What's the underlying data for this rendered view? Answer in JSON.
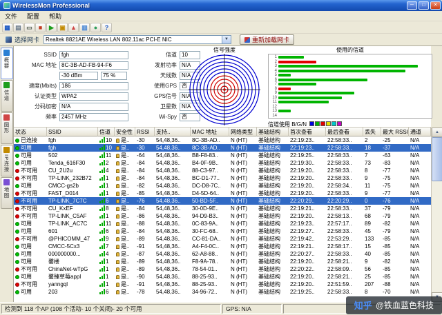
{
  "window": {
    "title": "WirelessMon Professional",
    "minimize_label": "─",
    "maximize_label": "□",
    "close_label": "✕"
  },
  "menu": {
    "items": [
      "文件",
      "配置",
      "帮助"
    ]
  },
  "toolbar": {
    "icons": [
      {
        "name": "save-icon",
        "glyph": "▦",
        "color": "#1a57c4"
      },
      {
        "name": "export-icon",
        "glyph": "▤",
        "color": "#6b7b8c"
      },
      {
        "name": "print-icon",
        "glyph": "▭",
        "color": "#556055"
      },
      {
        "name": "stop-icon",
        "glyph": "■",
        "color": "#c23b22"
      },
      {
        "name": "start-icon",
        "glyph": "▶",
        "color": "#1d9e1d"
      },
      {
        "name": "summary-icon",
        "glyph": "▣",
        "color": "#c28a00"
      },
      {
        "name": "graph-icon",
        "glyph": "▲",
        "color": "#d04545"
      },
      {
        "name": "channels-icon",
        "glyph": "▥",
        "color": "#3b7fd4"
      },
      {
        "name": "map-icon",
        "glyph": "●",
        "color": "#2e9e5b"
      },
      {
        "name": "help-icon",
        "glyph": "?",
        "color": "#1a57c4"
      }
    ]
  },
  "adapter": {
    "label": "选择网卡",
    "value": "Realtek 8821AE Wireless LAN 802.11ac PCI-E NIC",
    "reload_button": "重新加载网卡"
  },
  "icons": {
    "combo_arrow": "▼",
    "scroll_up": "▲",
    "scroll_down": "▼"
  },
  "sidebar": {
    "tabs": [
      {
        "label": "概要",
        "color": "#2a7fd4",
        "active": true
      },
      {
        "label": "信道",
        "color": "#1d9e1d",
        "active": false
      },
      {
        "label": "图形",
        "color": "#d04545",
        "active": false
      },
      {
        "label": "IP连接",
        "color": "#c28a00",
        "active": false
      },
      {
        "label": "地图",
        "color": "#7a4fd4",
        "active": false
      }
    ]
  },
  "summary": {
    "radar_title": "信号强度",
    "fields_left": [
      {
        "label": "SSID",
        "value": "fgh"
      },
      {
        "label": "MAC 地址",
        "value": "8C-3B-AD-FB-94-F6"
      },
      {
        "label": "",
        "value": "-30 dBm",
        "value2": "75 %"
      },
      {
        "label": "速度(Mbits)",
        "value": "186"
      },
      {
        "label": "认证类型",
        "value": "WPA2"
      },
      {
        "label": "分码加密",
        "value": "N/A"
      },
      {
        "label": "频率",
        "value": "2457 MHz"
      }
    ],
    "fields_right": [
      {
        "label": "信道",
        "value": "10"
      },
      {
        "label": "发射功率",
        "value": "N/A"
      },
      {
        "label": "天线数",
        "value": "N/A"
      },
      {
        "label": "使用GPS",
        "value": "否"
      },
      {
        "label": "GPS信号",
        "value": "N/A"
      },
      {
        "label": "卫星数",
        "value": "N/A"
      },
      {
        "label": "Wi-Spy",
        "value": "否"
      }
    ]
  },
  "chart_data": {
    "type": "bar",
    "orientation": "horizontal",
    "title": "使用的信道",
    "categories": [
      "1",
      "2",
      "3",
      "4",
      "5",
      "6",
      "7",
      "8",
      "9",
      "10",
      "11",
      "12",
      "13",
      "14"
    ],
    "values": [
      2,
      3,
      11,
      10,
      1,
      7,
      3,
      1,
      6,
      5,
      4,
      0,
      1,
      0
    ],
    "bar_colors": [
      "#00b400",
      "#e00000",
      "#00b400",
      "#00b400",
      "#00b400",
      "#00b400",
      "#00b400",
      "#e00000",
      "#00b400",
      "#00b400",
      "#00b400",
      "#00b400",
      "#00b400",
      "#00b400"
    ],
    "xlim": [
      0,
      12
    ],
    "legend_label": "信道使用 B/G/N",
    "legend_colors": [
      "#0000e0",
      "#00b400",
      "#e00000",
      "#e0e000",
      "#00c8c8",
      "#c800c8"
    ]
  },
  "table": {
    "columns": [
      "状态",
      "SSID",
      "信道",
      "安全性",
      "RSSI",
      "支持..",
      "MAC 地址",
      "网络类型",
      "基础结构",
      "首次查看",
      "最后查看",
      "丢失",
      "最大 RSSI",
      "通道"
    ],
    "rows": [
      {
        "status": "已连接",
        "dot": "#00c000",
        "ssid": "fgh",
        "channel": "10",
        "security": "是..",
        "rssi": "-30",
        "rates": "54,48,36..",
        "mac": "8C-3B-AD..",
        "type": "N (HT)",
        "infra": "基础结构",
        "first": "22:19:23..",
        "last": "22:58:33..",
        "lost": "2",
        "max_rssi": "-25",
        "extra": "N/A",
        "selected": false
      },
      {
        "status": "可用",
        "dot": "#00c000",
        "ssid": "fgh",
        "channel": "10",
        "security": "是..",
        "rssi": "-30",
        "rates": "54,48,36..",
        "mac": "8C-3B-AD..",
        "type": "N (HT)",
        "infra": "基础结构",
        "first": "22:19:23..",
        "last": "22:58:33..",
        "lost": "18",
        "max_rssi": "-37",
        "extra": "N/A",
        "selected": true
      },
      {
        "status": "可用",
        "dot": "#00c000",
        "ssid": "502",
        "channel": "11",
        "security": "是..",
        "rssi": "-64",
        "rates": "54,48,36..",
        "mac": "B8-F8-83..",
        "type": "N (HT)",
        "infra": "基础结构",
        "first": "22:19:25..",
        "last": "22:58:33..",
        "lost": "7",
        "max_rssi": "-63",
        "extra": "N/A",
        "selected": false
      },
      {
        "status": "可用",
        "dot": "#00c000",
        "ssid": "Tenda_616F30",
        "channel": "2",
        "security": "是..",
        "rssi": "-84",
        "rates": "54,48,36..",
        "mac": "B4-0F-9B..",
        "type": "N (HT)",
        "infra": "基础结构",
        "first": "22:19:30..",
        "last": "22:58:33..",
        "lost": "73",
        "max_rssi": "-83",
        "extra": "N/A",
        "selected": false
      },
      {
        "status": "不可用",
        "dot": "#e00000",
        "ssid": "CU_2U2u",
        "channel": "4",
        "security": "是..",
        "rssi": "-84",
        "rates": "54,48,36..",
        "mac": "88-C3-97..",
        "type": "N (HT)",
        "infra": "基础结构",
        "first": "22:19:20..",
        "last": "22:58:33..",
        "lost": "8",
        "max_rssi": "-77",
        "extra": "N/A",
        "selected": false
      },
      {
        "status": "不可用",
        "dot": "#e00000",
        "ssid": "TP-LINK_232B72",
        "channel": "1",
        "security": "是..",
        "rssi": "-84",
        "rates": "54,48,36..",
        "mac": "BC-D1-77..",
        "type": "N (HT)",
        "infra": "基础结构",
        "first": "22:19:20..",
        "last": "22:58:33..",
        "lost": "9",
        "max_rssi": "-75",
        "extra": "N/A",
        "selected": false
      },
      {
        "status": "可用",
        "dot": "#00c000",
        "ssid": "CMCC-gs2b",
        "channel": "1",
        "security": "是..",
        "rssi": "-82",
        "rates": "54,48,36..",
        "mac": "DC-D8-7C..",
        "type": "N (HT)",
        "infra": "基础结构",
        "first": "22:19:20..",
        "last": "22:58:34..",
        "lost": "11",
        "max_rssi": "-75",
        "extra": "N/A",
        "selected": false
      },
      {
        "status": "不可用",
        "dot": "#e00000",
        "ssid": "FAST_D014",
        "channel": "1",
        "security": "是..",
        "rssi": "-85",
        "rates": "54,48,36..",
        "mac": "D4-5D-64..",
        "type": "N (HT)",
        "infra": "基础结构",
        "first": "22:19:20..",
        "last": "22:58:33..",
        "lost": "9",
        "max_rssi": "-77",
        "extra": "N/A",
        "selected": false
      },
      {
        "status": "不可用",
        "dot": "#e00000",
        "ssid": "TP-LINK_7C7C",
        "channel": "6",
        "security": "是..",
        "rssi": "-76",
        "rates": "54,48,36..",
        "mac": "50-BD-5F..",
        "type": "N (HT)",
        "infra": "基础结构",
        "first": "22:20:29..",
        "last": "22:20:29..",
        "lost": "0",
        "max_rssi": "-76",
        "extra": "N/A",
        "selected": true
      },
      {
        "status": "不可用",
        "dot": "#e00000",
        "ssid": "CU_KxEF",
        "channel": "8",
        "security": "是..",
        "rssi": "-84",
        "rates": "54,48,36..",
        "mac": "30-0D-9E..",
        "type": "N (HT)",
        "infra": "基础结构",
        "first": "22:19:21..",
        "last": "22:58:33..",
        "lost": "37",
        "max_rssi": "-79",
        "extra": "N/A",
        "selected": false
      },
      {
        "status": "不可用",
        "dot": "#e00000",
        "ssid": "TP-LINK_C5AF",
        "channel": "1",
        "security": "是..",
        "rssi": "-86",
        "rates": "54,48,36..",
        "mac": "94-D9-B3..",
        "type": "N (HT)",
        "infra": "基础结构",
        "first": "22:19:20..",
        "last": "22:58:13..",
        "lost": "68",
        "max_rssi": "-79",
        "extra": "N/A",
        "selected": false
      },
      {
        "status": "可用",
        "dot": "#00c000",
        "ssid": "TP-LINK_AC7C",
        "channel": "11",
        "security": "是..",
        "rssi": "-88",
        "rates": "54,48,36..",
        "mac": "0C-83-9A..",
        "type": "N (HT)",
        "infra": "基础结构",
        "first": "22:19:23..",
        "last": "22:57:17..",
        "lost": "89",
        "max_rssi": "-82",
        "extra": "N/A",
        "selected": false
      },
      {
        "status": "可用",
        "dot": "#00c000",
        "ssid": "601",
        "channel": "6",
        "security": "是..",
        "rssi": "-84",
        "rates": "54,48,36..",
        "mac": "30-FC-68..",
        "type": "N (HT)",
        "infra": "基础结构",
        "first": "22:19:27..",
        "last": "22:58:33..",
        "lost": "45",
        "max_rssi": "-79",
        "extra": "N/A",
        "selected": false
      },
      {
        "status": "不可用",
        "dot": "#e00000",
        "ssid": "@PHICOMM_47",
        "channel": "9",
        "security": "是..",
        "rssi": "-89",
        "rates": "54,48,36..",
        "mac": "CC-81-DA..",
        "type": "N (HT)",
        "infra": "基础结构",
        "first": "22:19:42..",
        "last": "22:53:29..",
        "lost": "133",
        "max_rssi": "-85",
        "extra": "N/A",
        "selected": false
      },
      {
        "status": "可用",
        "dot": "#00c000",
        "ssid": "CMCC-5Cx3",
        "channel": "7",
        "security": "是..",
        "rssi": "-91",
        "rates": "54,48,36..",
        "mac": "A4-F4-0C..",
        "type": "N (HT)",
        "infra": "基础结构",
        "first": "22:19:21..",
        "last": "22:58:17..",
        "lost": "15",
        "max_rssi": "-85",
        "extra": "N/A",
        "selected": false
      },
      {
        "status": "可用",
        "dot": "#00c000",
        "ssid": "000000000...",
        "channel": "4",
        "security": "是..",
        "rssi": "-87",
        "rates": "54,48,36..",
        "mac": "62-A8-88..",
        "type": "N (HT)",
        "infra": "基础结构",
        "first": "22:20:27..",
        "last": "22:58:33..",
        "lost": "40",
        "max_rssi": "-85",
        "extra": "N/A",
        "selected": false
      },
      {
        "status": "可用",
        "dot": "#00c000",
        "ssid": "馨楼",
        "channel": "1",
        "security": "是..",
        "rssi": "-89",
        "rates": "54,48,36..",
        "mac": "F8-9A-78..",
        "type": "N (HT)",
        "infra": "基础结构",
        "first": "22:19:20..",
        "last": "22:58:21..",
        "lost": "9",
        "max_rssi": "-82",
        "extra": "N/A",
        "selected": false
      },
      {
        "status": "不可用",
        "dot": "#e00000",
        "ssid": "ChinaNet-wTpG",
        "channel": "1",
        "security": "是..",
        "rssi": "-89",
        "rates": "54,48,36..",
        "mac": "78-54-01..",
        "type": "N (HT)",
        "infra": "基础结构",
        "first": "22:20:22..",
        "last": "22:58:09..",
        "lost": "56",
        "max_rssi": "-85",
        "extra": "N/A",
        "selected": false
      },
      {
        "status": "可用",
        "dot": "#00c000",
        "ssid": "馨臻草莓appl",
        "channel": "1",
        "security": "是..",
        "rssi": "-90",
        "rates": "54,48,36..",
        "mac": "88-25-93..",
        "type": "N (HT)",
        "infra": "基础结构",
        "first": "22:19:20..",
        "last": "22:58:21..",
        "lost": "25",
        "max_rssi": "-85",
        "extra": "N/A",
        "selected": false
      },
      {
        "status": "不可用",
        "dot": "#e00000",
        "ssid": "yanngql",
        "channel": "1",
        "security": "是..",
        "rssi": "-91",
        "rates": "54,48,36..",
        "mac": "88-25-93..",
        "type": "N (HT)",
        "infra": "基础结构",
        "first": "22:19:20..",
        "last": "22:51:59..",
        "lost": "207",
        "max_rssi": "-88",
        "extra": "N/A",
        "selected": false
      },
      {
        "status": "可用",
        "dot": "#00c000",
        "ssid": "203",
        "channel": "6",
        "security": "是..",
        "rssi": "-78",
        "rates": "54,48,36..",
        "mac": "34-96-72..",
        "type": "N (HT)",
        "infra": "基础结构",
        "first": "22:19:25..",
        "last": "22:58:33..",
        "lost": "8",
        "max_rssi": "-70",
        "extra": "N/A",
        "selected": false
      }
    ]
  },
  "status_bar": {
    "detected": "检测到 118 个AP (108 个活动- 10 个关闭)- 20 个可用",
    "gps": "GPS: N/A"
  },
  "watermark": {
    "brand": "知乎",
    "text": "@铁血蓝色科技"
  }
}
